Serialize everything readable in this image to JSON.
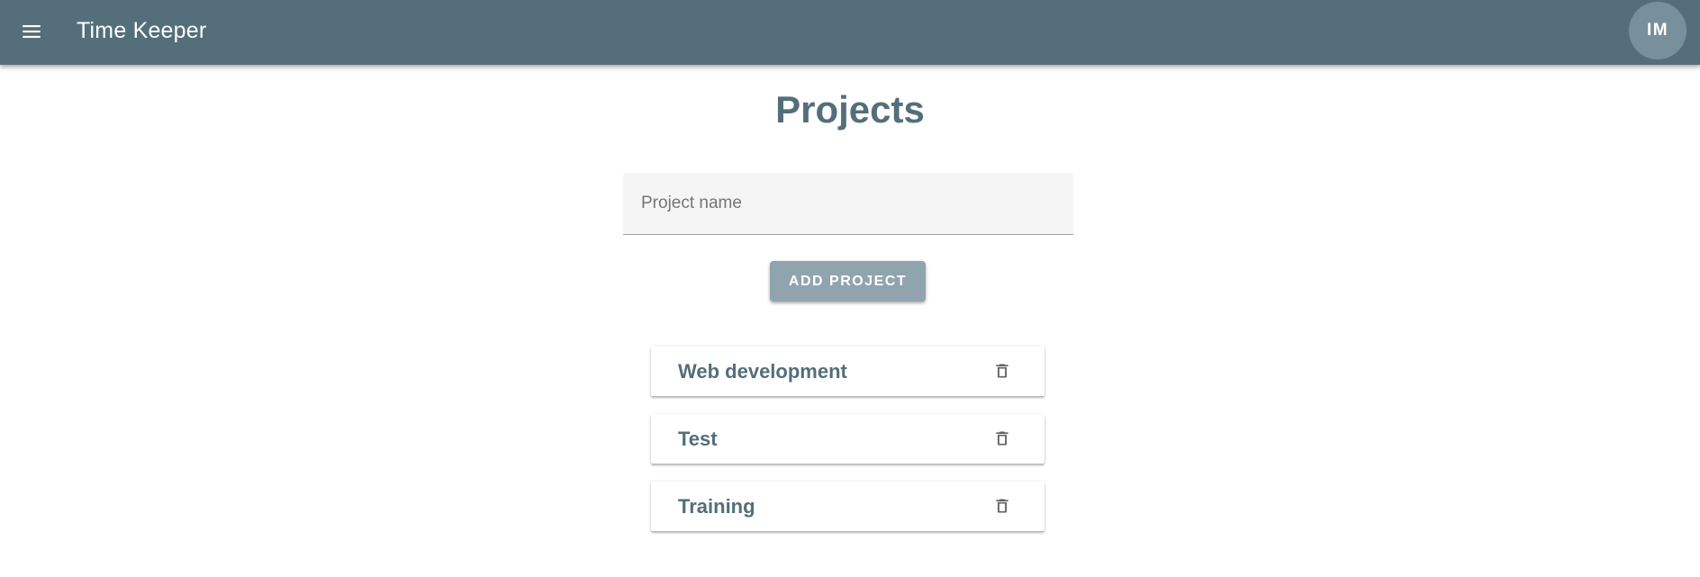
{
  "appbar": {
    "title": "Time Keeper",
    "menu_icon": "menu-icon",
    "avatar_initials": "IM",
    "background_color": "#546e7a"
  },
  "main": {
    "page_title": "Projects",
    "project_name_field": {
      "placeholder": "Project name",
      "value": ""
    },
    "add_button_label": "ADD PROJECT",
    "projects": [
      {
        "name": "Web development",
        "delete_icon": "trash-icon"
      },
      {
        "name": "Test",
        "delete_icon": "trash-icon"
      },
      {
        "name": "Training",
        "delete_icon": "trash-icon"
      }
    ]
  },
  "colors": {
    "primary": "#546e7a",
    "button": "#90a4ae",
    "avatar": "#78909c"
  }
}
